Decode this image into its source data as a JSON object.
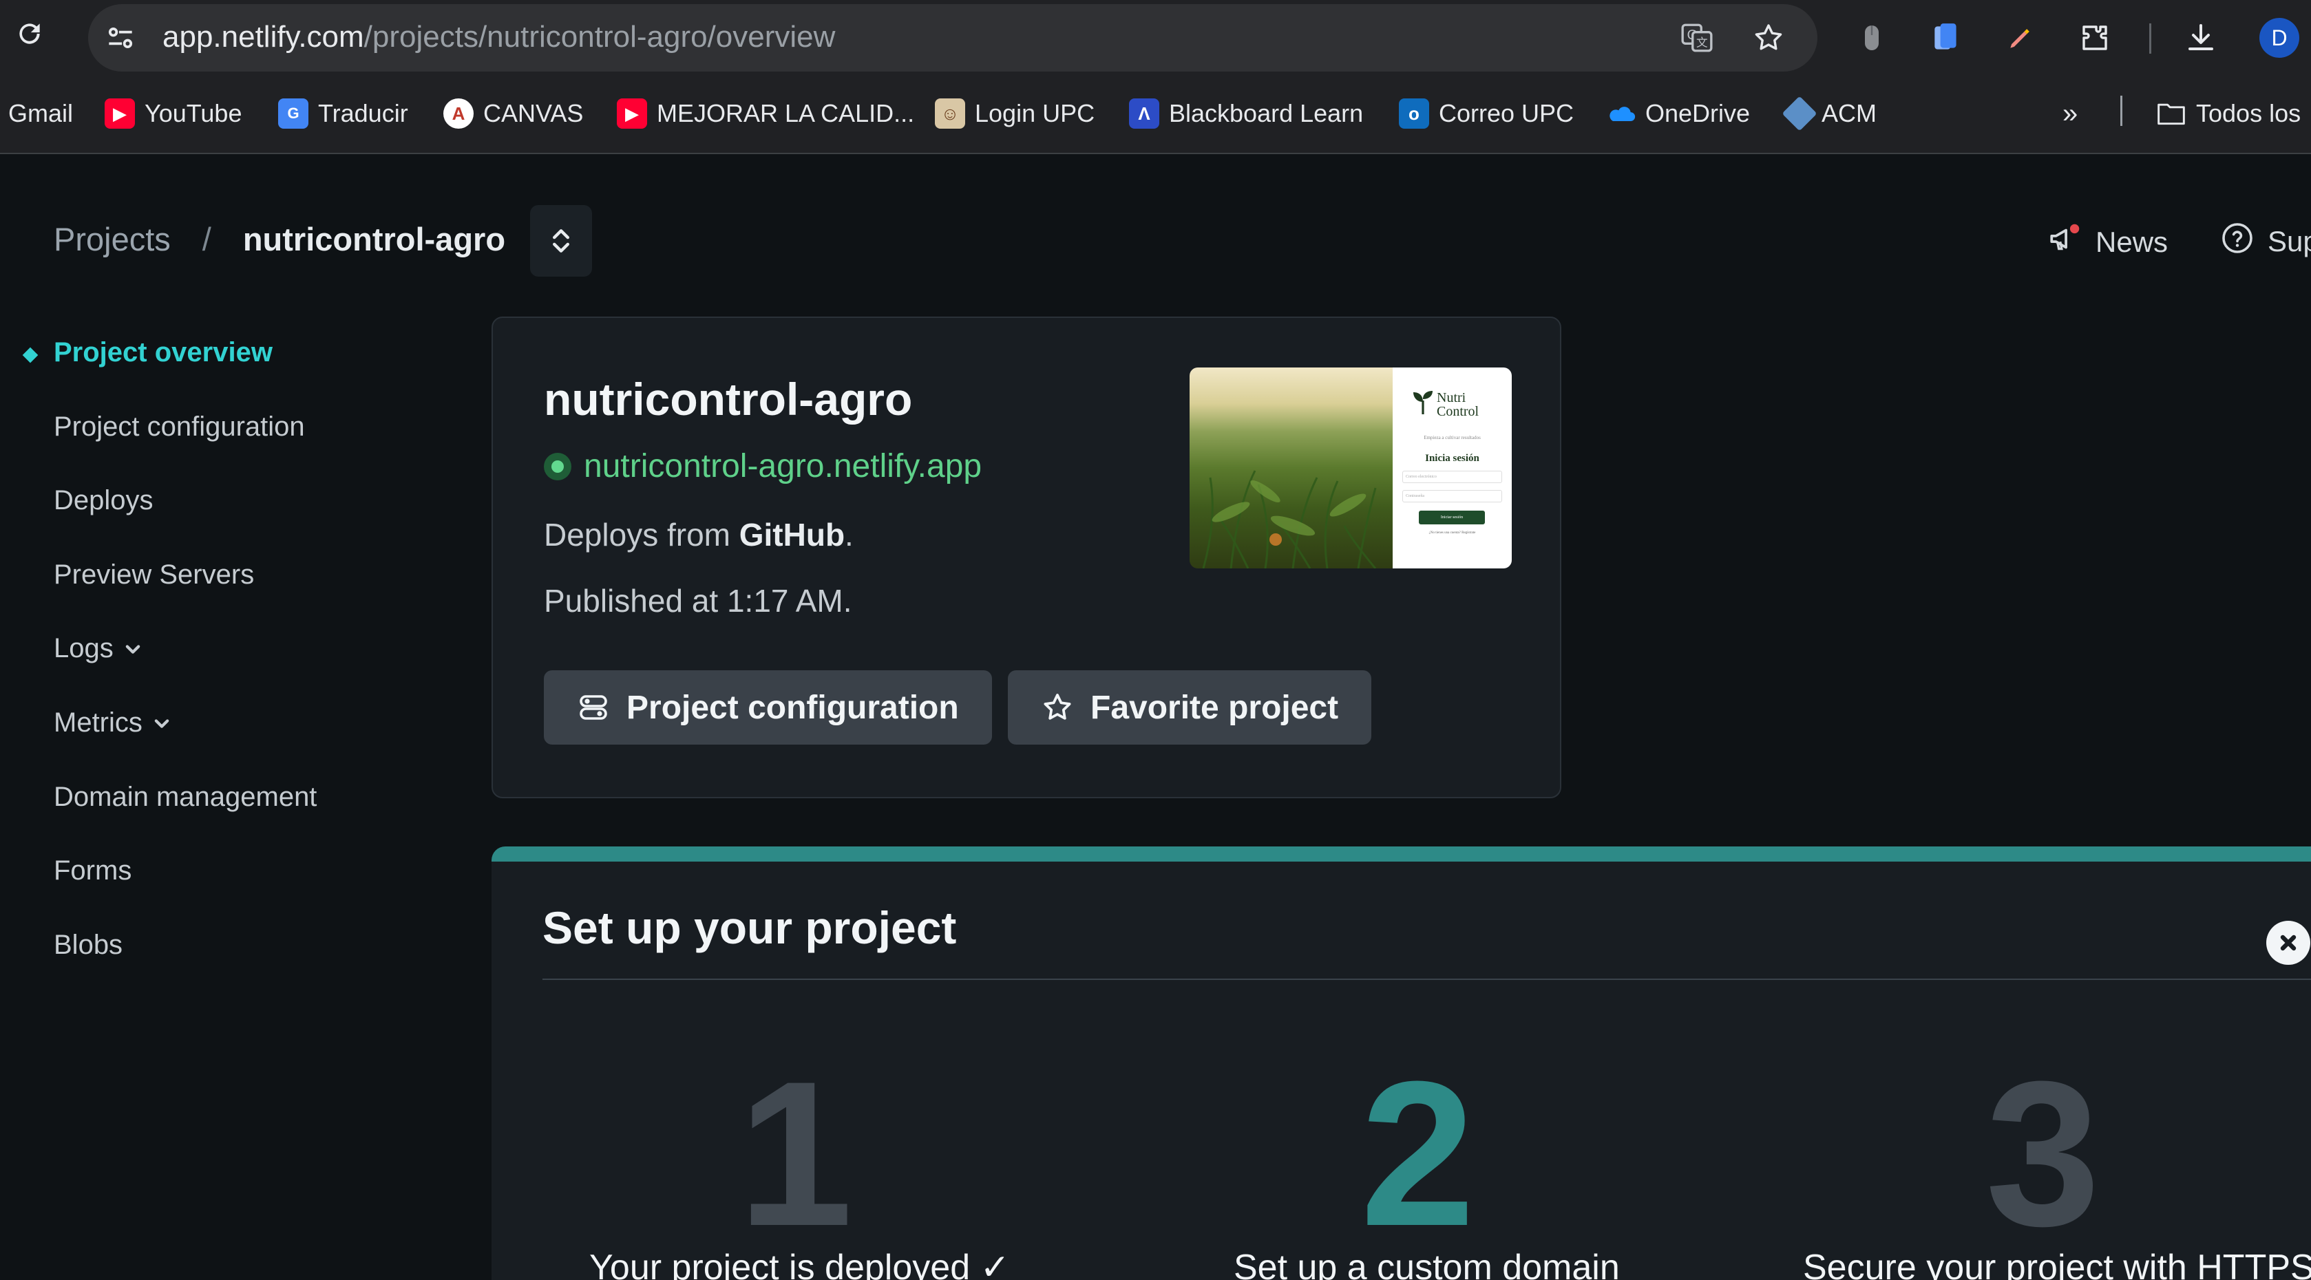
{
  "browser": {
    "url_host": "app.netlify.com",
    "url_path": "/projects/nutricontrol-agro/overview",
    "profile_initial": "D",
    "bookmarks": [
      {
        "label": "Gmail",
        "icon": "gmail-icon"
      },
      {
        "label": "YouTube",
        "icon": "youtube-icon"
      },
      {
        "label": "Traducir",
        "icon": "translate-icon"
      },
      {
        "label": "CANVAS",
        "icon": "canvas-icon"
      },
      {
        "label": "MEJORAR LA CALID...",
        "icon": "youtube-icon"
      },
      {
        "label": "Login UPC",
        "icon": "upc-icon"
      },
      {
        "label": "Blackboard Learn",
        "icon": "blackboard-icon"
      },
      {
        "label": "Correo UPC",
        "icon": "outlook-icon"
      },
      {
        "label": "OneDrive",
        "icon": "onedrive-icon"
      },
      {
        "label": "ACM",
        "icon": "acm-icon"
      }
    ],
    "more_bookmarks": "»",
    "all_bookmarks": "Todos los"
  },
  "header": {
    "breadcrumb_root": "Projects",
    "breadcrumb_sep": "/",
    "breadcrumb_current": "nutricontrol-agro",
    "news_label": "News",
    "support_label": "Sup"
  },
  "sidebar": {
    "items": [
      {
        "label": "Project overview",
        "active": true
      },
      {
        "label": "Project configuration"
      },
      {
        "label": "Deploys"
      },
      {
        "label": "Preview Servers"
      },
      {
        "label": "Logs",
        "chevron": true
      },
      {
        "label": "Metrics",
        "chevron": true
      },
      {
        "label": "Domain management"
      },
      {
        "label": "Forms"
      },
      {
        "label": "Blobs"
      }
    ]
  },
  "project_card": {
    "name": "nutricontrol-agro",
    "site_url": "nutricontrol-agro.netlify.app",
    "deploys_prefix": "Deploys from",
    "deploys_source": "GitHub",
    "deploys_suffix": ".",
    "published": "Published at 1:17 AM.",
    "config_button": "Project configuration",
    "favorite_button": "Favorite project",
    "preview": {
      "brand_line1": "Nutri",
      "brand_line2": "Control",
      "tagline": "Empieza a cultivar resultados",
      "heading": "Inicia sesión",
      "email_placeholder": "Correo electrónico",
      "password_placeholder": "Contraseña",
      "button": "Iniciar sesión",
      "footer": "¿No tienes una cuenta? Regístrate"
    }
  },
  "setup": {
    "title": "Set up your project",
    "steps": [
      {
        "number": "1",
        "label": "Your project is deployed ✓",
        "color": "#414951"
      },
      {
        "number": "2",
        "label": "Set up a custom domain",
        "color": "#2d8a87"
      },
      {
        "number": "3",
        "label": "Secure your project with HTTPS",
        "color": "#414951"
      }
    ]
  }
}
